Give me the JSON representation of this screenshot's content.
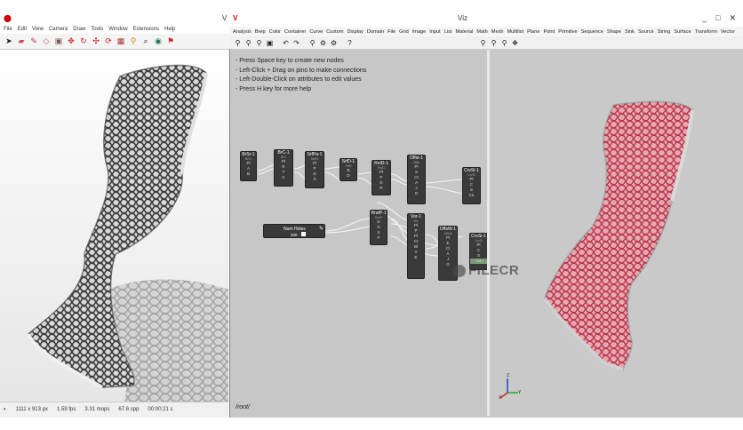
{
  "left_window": {
    "title_letter": "V",
    "menu": [
      "File",
      "Edit",
      "View",
      "Camera",
      "Draw",
      "Tools",
      "Window",
      "Extensions",
      "Help"
    ],
    "status": {
      "resolution": "1111 x 913 px",
      "fps": "1.59 fps",
      "mops": "3.31 mops",
      "spp": "67.6 spp",
      "time": "00:00:21 s"
    }
  },
  "right_window": {
    "title": "Viz",
    "controls": [
      "_",
      "□",
      "✕"
    ],
    "menu": [
      "Analysis",
      "Brep",
      "Color",
      "Container",
      "Curve",
      "Custom",
      "Display",
      "Domain",
      "File",
      "Grid",
      "Image",
      "Input",
      "List",
      "Material",
      "Math",
      "Mesh",
      "Multilist",
      "Plane",
      "Point",
      "Primitive",
      "Sequence",
      "Shape",
      "Sink",
      "Source",
      "String",
      "Surface",
      "Transform",
      "Vector"
    ],
    "help": [
      "- Press Space key to create new nodes",
      "- Left-Click + Drag on pins to make connections",
      "- Left-Double-Click on attributes to edit values",
      "- Press H key for more help"
    ],
    "path": "/root/",
    "slider": {
      "label": "Num Holes",
      "value": "200"
    },
    "nodes": [
      {
        "title": "BrSr-1",
        "sub": "BrSr",
        "pins": [
          "Pl",
          "A",
          "B"
        ]
      },
      {
        "title": "BrC-1",
        "sub": "BrC",
        "pins": [
          "Pl",
          "R",
          "T",
          "C"
        ]
      },
      {
        "title": "SrfPa-1",
        "sub": "SrfPa",
        "pins": [
          "Pl",
          "P",
          "D",
          "S"
        ]
      },
      {
        "title": "SrfD-1",
        "sub": "SrfD",
        "pins": [
          "B",
          "D"
        ]
      },
      {
        "title": "RctD-1",
        "sub": "RctD",
        "pins": [
          "Pl",
          "P",
          "D",
          "R"
        ]
      },
      {
        "title": "OffsI-1",
        "sub": "OffsI",
        "pins": [
          "Pl",
          "S",
          "Ct",
          "A",
          "J",
          "O"
        ]
      },
      {
        "title": "CrvSi-1",
        "sub": "CrvSi",
        "pins": [
          "Pl",
          "C",
          "S",
          "Ca"
        ]
      },
      {
        "title": "RndP-1",
        "sub": "RndP",
        "pins": [
          "D",
          "N",
          "S",
          "P"
        ]
      },
      {
        "title": "Vor-1",
        "sub": "Vor",
        "pins": [
          "Pl",
          "P",
          "Pl",
          "Ct",
          "Bl",
          "V",
          "E"
        ]
      },
      {
        "title": "OffsW-1",
        "sub": "OffsW",
        "pins": [
          "Pl",
          "E",
          "Cl",
          "A",
          "J",
          "O"
        ]
      },
      {
        "title": "CrvSi-1",
        "sub": "CrvSi",
        "pins": [
          "Pl",
          "C",
          "S",
          "Ca"
        ]
      }
    ],
    "watermark": "FILECR",
    "axis_labels": [
      "Z",
      "Y",
      "X"
    ]
  },
  "colors": {
    "node_bg": "#3a3a3a",
    "canvas_bg": "#c7c7c7",
    "chair_pink": "#e05a6a",
    "accent_red": "#cc0000"
  }
}
